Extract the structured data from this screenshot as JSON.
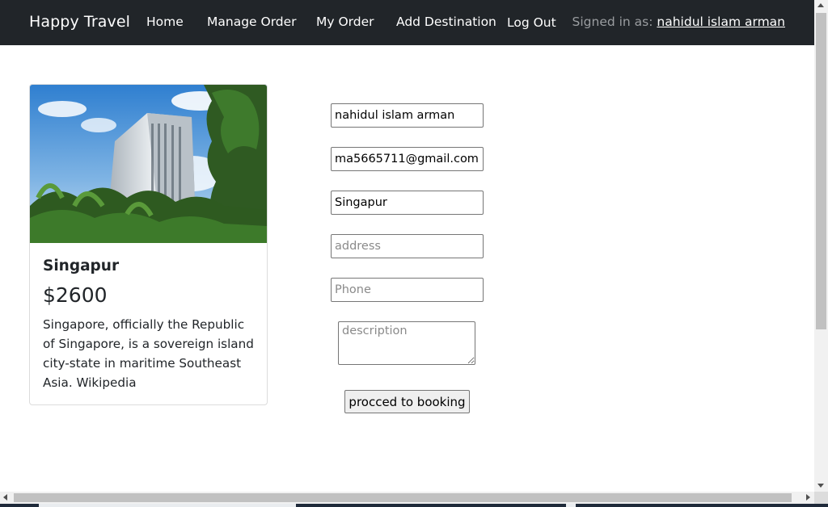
{
  "navbar": {
    "brand": "Happy Travel",
    "links": [
      {
        "label": "Home"
      },
      {
        "label": "Manage Order"
      },
      {
        "label": "My Order"
      },
      {
        "label": "Add Destination"
      },
      {
        "label": "Log Out"
      }
    ],
    "signed_in_prefix": "Signed in as: ",
    "signed_in_user": "nahidul islam arman"
  },
  "card": {
    "image_icon": "building-photo",
    "title": "Singapur",
    "price": "$2600",
    "description": "Singapore, officially the Republic of Singapore, is a sovereign island city-state in maritime Southeast Asia. Wikipedia"
  },
  "form": {
    "name": {
      "value": "nahidul islam arman",
      "placeholder": ""
    },
    "email": {
      "value": "ma5665711@gmail.com",
      "placeholder": ""
    },
    "destination": {
      "value": "Singapur",
      "placeholder": ""
    },
    "address": {
      "value": "",
      "placeholder": "address"
    },
    "phone": {
      "value": "",
      "placeholder": "Phone"
    },
    "description": {
      "value": "",
      "placeholder": "description"
    },
    "submit_label": "procced to booking"
  },
  "colors": {
    "navbar_bg": "#212529",
    "nav_text": "#ffffff",
    "muted_text": "#9a9da0"
  }
}
